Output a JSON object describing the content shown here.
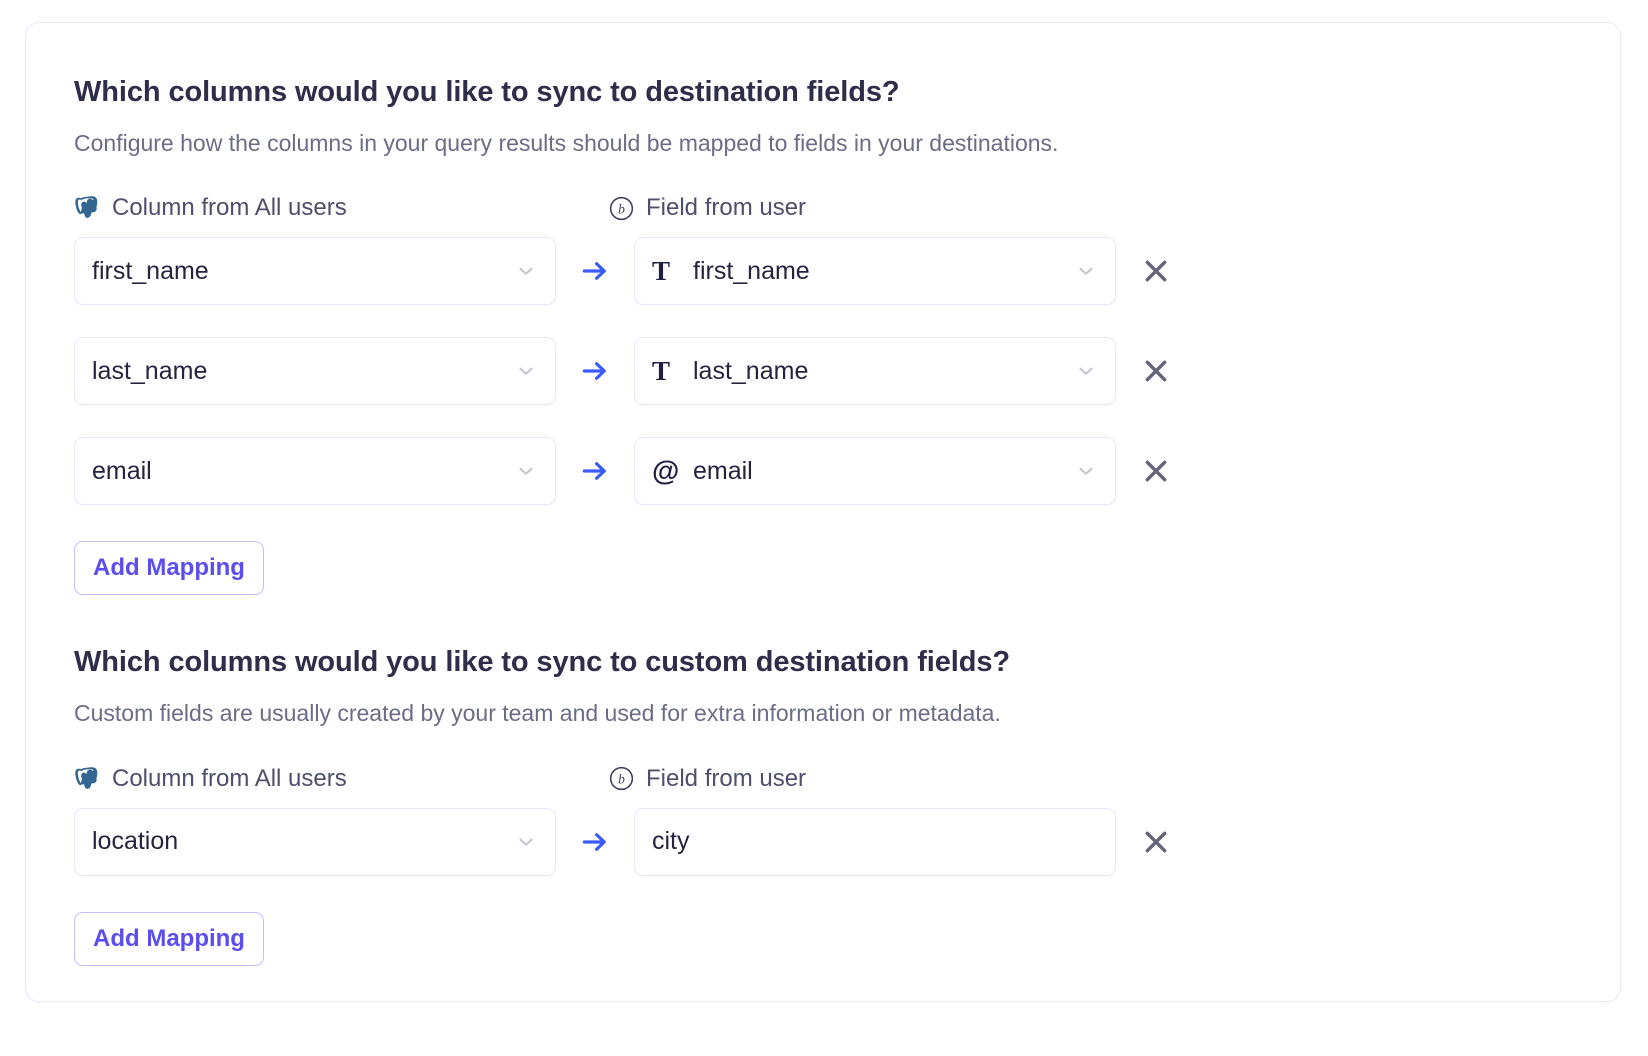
{
  "card": {
    "sections": [
      {
        "id": "standard",
        "title": "Which columns would you like to sync to destination fields?",
        "subtitle": "Configure how the columns in your query results should be mapped to fields in your destinations.",
        "source_header": {
          "icon": "postgresql-icon",
          "label": "Column from All users"
        },
        "destination_header": {
          "icon": "braze-icon",
          "label": "Field from user"
        },
        "arrow_icon": "arrow-right-icon",
        "remove_icon": "close-icon",
        "chevron_icon": "chevron-down-icon",
        "rows": [
          {
            "source": "first_name",
            "destination": "first_name",
            "destination_type_icon": "text-type-icon",
            "destination_type_glyph": "T",
            "destination_kind": "select"
          },
          {
            "source": "last_name",
            "destination": "last_name",
            "destination_type_icon": "text-type-icon",
            "destination_type_glyph": "T",
            "destination_kind": "select"
          },
          {
            "source": "email",
            "destination": "email",
            "destination_type_icon": "email-type-icon",
            "destination_type_glyph": "@",
            "destination_kind": "select"
          }
        ],
        "add_button_label": "Add Mapping"
      },
      {
        "id": "custom",
        "title": "Which columns would you like to sync to custom destination fields?",
        "subtitle": "Custom fields are usually created by your team and used for extra information or metadata.",
        "source_header": {
          "icon": "postgresql-icon",
          "label": "Column from All users"
        },
        "destination_header": {
          "icon": "braze-icon",
          "label": "Field from user"
        },
        "arrow_icon": "arrow-right-icon",
        "remove_icon": "close-icon",
        "chevron_icon": "chevron-down-icon",
        "rows": [
          {
            "source": "location",
            "destination": "city",
            "destination_type_icon": null,
            "destination_type_glyph": "",
            "destination_kind": "text"
          }
        ],
        "add_button_label": "Add Mapping"
      }
    ]
  },
  "colors": {
    "accent_arrow": "#3b5bfd",
    "accent_button_text": "#5b4df0",
    "accent_button_border": "#c9bdf7",
    "field_border": "#e6e7f8",
    "card_border": "#e6e8f7",
    "title_text": "#2e2e4a",
    "subtitle_text": "#6b6d86",
    "value_text": "#24243f",
    "chevron": "#c7c7d2",
    "close_icon": "#636379"
  }
}
